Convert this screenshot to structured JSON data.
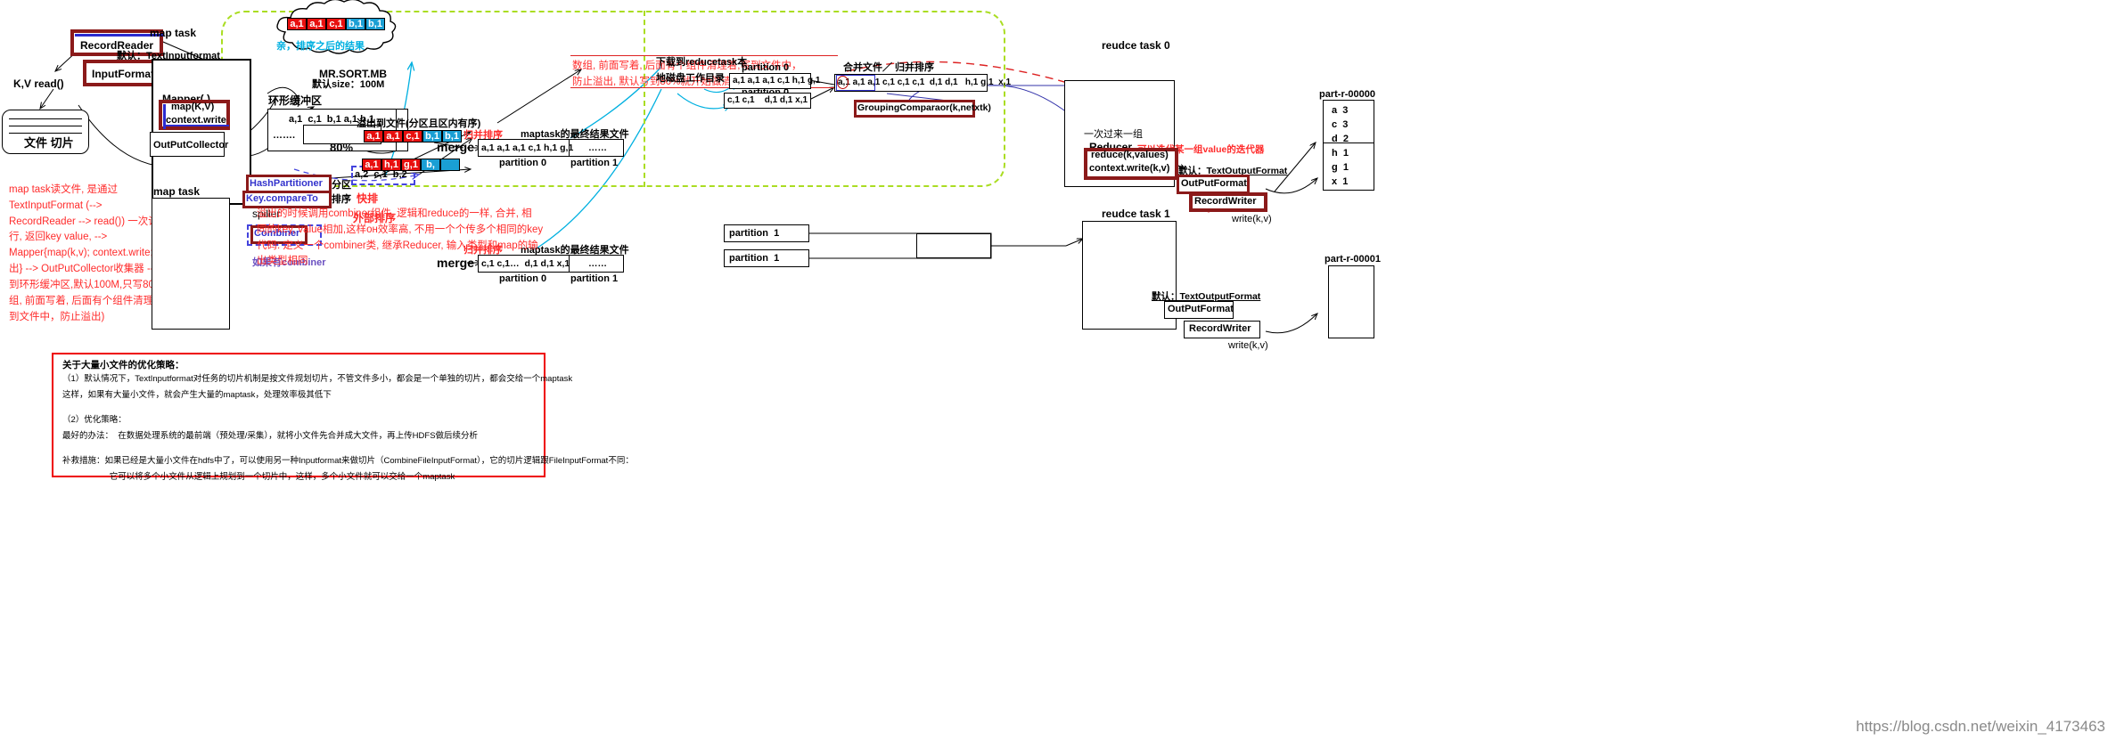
{
  "meta": {
    "watermark": "https://blog.csdn.net/weixin_4173463"
  },
  "map_side": {
    "record_reader": "RecordReader",
    "input_format": "InputFormat",
    "input_format_default": "默认：TextInputformat",
    "kv_read": "K,V read()",
    "file_split": "文件 切片",
    "map_task_label": "map task",
    "map_task_label2": "map task",
    "mapper_label": "Mapper( )",
    "map_kv": "map(K,V)",
    "context_write": "context.write",
    "output_collector": "OutPutCollector",
    "ring_buffer_label": "环形缓冲区",
    "buffer_content": "a,1  c,1  b,1 a,1 b,1",
    "buffer_dots": "…….",
    "mr_sort_mb": "MR.SORT.MB",
    "mr_sort_size": "默认size：100M",
    "pct80": "80%",
    "hash_partitioner": "HashPartitioner",
    "key_compareto": "Key.compareTo",
    "partition_cn": "分区",
    "sort_cn": "排序",
    "quicksort_cn": "快排",
    "external_sort_cn": "外部排序",
    "spiller": "spiller",
    "combiner": "Combiner",
    "if_combiner": "如果有combiner",
    "spill_to_file": "溢出到文件(分区且区内有序)",
    "merge_label": "merge",
    "merge_sort_cn": "归并排序",
    "merge_sort_cn2": "归并排序",
    "maptask_final": "maptask的最终结果文件",
    "maptask_final2": "maptask的最终结果文件",
    "partition0": "partition 0",
    "partition1": "partition 1",
    "combiner_result": "a,2  c,1  b,2"
  },
  "cloud": {
    "caption": "亲，排序之后的结果",
    "cells": [
      {
        "text": "a,1",
        "color": "#e8100f"
      },
      {
        "text": "a,1",
        "color": "#e8100f"
      },
      {
        "text": "c,1",
        "color": "#e8100f"
      },
      {
        "text": "b,1",
        "color": "#1a9fd4"
      },
      {
        "text": "b,1",
        "color": "#1a9fd4"
      }
    ]
  },
  "spill_rows": [
    {
      "cells": [
        {
          "text": "a,1",
          "color": "#e8100f"
        },
        {
          "text": "a,1",
          "color": "#e8100f"
        },
        {
          "text": "c,1",
          "color": "#e8100f"
        },
        {
          "text": "b,1",
          "color": "#1a9fd4"
        },
        {
          "text": "b,1",
          "color": "#1a9fd4"
        }
      ]
    },
    {
      "cells": [
        {
          "text": "a,1",
          "color": "#e8100f"
        },
        {
          "text": "h,1",
          "color": "#e8100f"
        },
        {
          "text": "g,1",
          "color": "#e8100f"
        },
        {
          "text": "b,",
          "color": "#1a9fd4"
        },
        {
          "text": "",
          "color": "#1a9fd4"
        }
      ]
    }
  ],
  "merge_tables": [
    {
      "content": "a,1 a,1 a,1 c,1 h,1 g,1",
      "dots": "……",
      "p0": "partition 0",
      "p1": "partition 1"
    },
    {
      "content": "c,1 c,1…  d,1 d,1 x,1",
      "dots": "……",
      "p0": "partition 0",
      "p1": "partition 1"
    }
  ],
  "reduce_side": {
    "download_label": "下载到reducetask本",
    "disk_label": "地磁盘工作目录",
    "partition0_a": "partition 0",
    "partition0_b": "partition 0",
    "row_a": "a,1 a,1 a,1 c,1 h,1 g,1",
    "row_b": "c,1 c,1    d,1 d,1 x,1",
    "merge_files": "合并文件／ 归并排序",
    "merged_row": "a,1 a,1 a,1 c,1 c,1 c,1  d,1 d,1   h,1 g,1  x,1",
    "grouping_comparator": "GroupingComparaor(k,netxtk)",
    "partition1_a": "partition  1",
    "partition1_b": "partition  1",
    "reduce_task0": "reudce task 0",
    "reduce_task1": "reudce task 1",
    "one_group": "一次过来一组",
    "reducer": "Reducer",
    "iterator_note": "可以迭代某一组value的迭代器",
    "reduce_kvalues": "reduce(k,values)",
    "context_write_kv": "context.write(k,v)",
    "default_text_output": "默认：TextOutputFormat",
    "default_text_output2": "默认：TextOutputFormat",
    "output_format": "OutPutFormat",
    "output_format2": "OutPutFormat",
    "record_writer": "RecordWriter",
    "record_writer2": "RecordWriter",
    "write_kv": "write(k,v)",
    "write_kv2": "write(k,v)"
  },
  "outputs": [
    {
      "name": "part-r-00000",
      "rows": [
        "a  3",
        "c  3",
        "d  2",
        "h  1",
        "g  1",
        "x  1"
      ]
    },
    {
      "name": "part-r-00001",
      "rows": []
    }
  ],
  "notes": {
    "left_red": "map task读文件, 是通过\nTextInputFormat (-->\nRecordReader --> read()) 一次读一\n行, 返回key value, -->\nMapper{map(k,v); context.write;输\n出} --> OutPutCollector收集器 -->写\n到环形缓冲区,默认100M,只写80%(数\n组, 前面写着, 后面有个组件清理着,写\n到文件中，防止溢出)",
    "top_red": "数组, 前面写着, 后面有个组件清理着,写到文件中，\n防止溢出, 默认写到80%就开始做清理工作",
    "combiner_red": "溢出的时候调用combiner组件, 逻辑和reduce的一样, 合并, 相\n同的key, value相加,这样он效率高, 不用一个个传多个相同的key\n代码: 定义一个combiner类, 继承Reducer, 输入类型和map的输\n出类型相同"
  },
  "bottom_box": {
    "title": "关于大量小文件的优化策略：",
    "lines": [
      "（1）默认情况下，TextInputformat对任务的切片机制是按文件规划切片，不管文件多小，都会是一个单独的切片，都会交给一个maptask",
      "这样，如果有大量小文件，就会产生大量的maptask，处理效率极其低下",
      "",
      "（2）优化策略：",
      "最好的办法：  在数据处理系统的最前端（预处理/采集），就将小文件先合并成大文件，再上传HDFS做后续分析",
      "",
      "补救措施：如果已经是大量小文件在hdfs中了，可以使用另一种Inputformat来做切片（CombineFileInputFormat），它的切片逻辑跟FileInputFormat不同：",
      "                    它可以将多个小文件从逻辑上规划到一个切片中，这样，多个小文件就可以交给一个maptask"
    ]
  }
}
